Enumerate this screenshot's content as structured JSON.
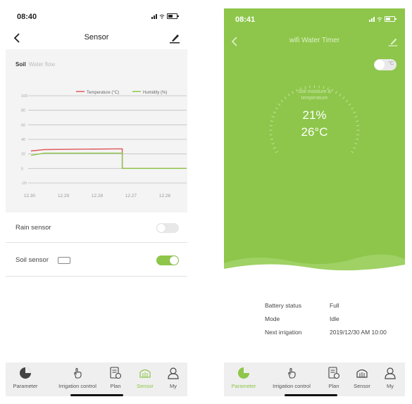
{
  "left": {
    "status": {
      "time": "08:40"
    },
    "nav": {
      "title": "Sensor"
    },
    "tabs": {
      "active": "Soil",
      "inactive": "Water flow"
    },
    "chart_data": {
      "type": "line",
      "legend": [
        "Temperature (°C)",
        "Humidity (%)"
      ],
      "y_ticks": [
        "100",
        "80",
        "60",
        "40",
        "20",
        "0",
        "-20"
      ],
      "x_ticks": [
        "12.30",
        "12.29",
        "12.28",
        "12.27",
        "12.26"
      ],
      "ylim": [
        -20,
        100
      ],
      "series": [
        {
          "name": "Temperature (°C)",
          "color": "#e05a5a",
          "x": [
            0,
            0.4,
            2.7,
            2.7,
            4.6
          ],
          "values": [
            24,
            26,
            27,
            0,
            0
          ]
        },
        {
          "name": "Humidity (%)",
          "color": "#8dc64a",
          "x": [
            0,
            0.4,
            2.7,
            2.7,
            4.6
          ],
          "values": [
            18,
            21,
            21,
            0,
            0
          ]
        }
      ]
    },
    "rain_sensor": {
      "label": "Rain sensor",
      "on": false
    },
    "soil_sensor": {
      "label": "Soil sensor",
      "on": true
    },
    "tabbar": [
      "Parameter",
      "Irrigation control",
      "Plan",
      "Sensor",
      "My"
    ]
  },
  "right": {
    "status": {
      "time": "08:41"
    },
    "nav": {
      "title": "wifi Water Timer"
    },
    "unit_toggle": "°C",
    "gauge": {
      "title_line1": "Soil moisture &",
      "title_line2": "temperature",
      "moisture": "21%",
      "temperature": "26°C"
    },
    "info": {
      "battery_label": "Battery status",
      "battery_value": "Full",
      "mode_label": "Mode",
      "mode_value": "Idle",
      "next_label": "Next irrigation",
      "next_value": "2019/12/30 AM 10:00"
    },
    "tabbar": [
      "Parameter",
      "Irrigation control",
      "Plan",
      "Sensor",
      "My"
    ]
  },
  "colors": {
    "accent_green": "#8dc64a",
    "temp_red": "#e05a5a"
  }
}
